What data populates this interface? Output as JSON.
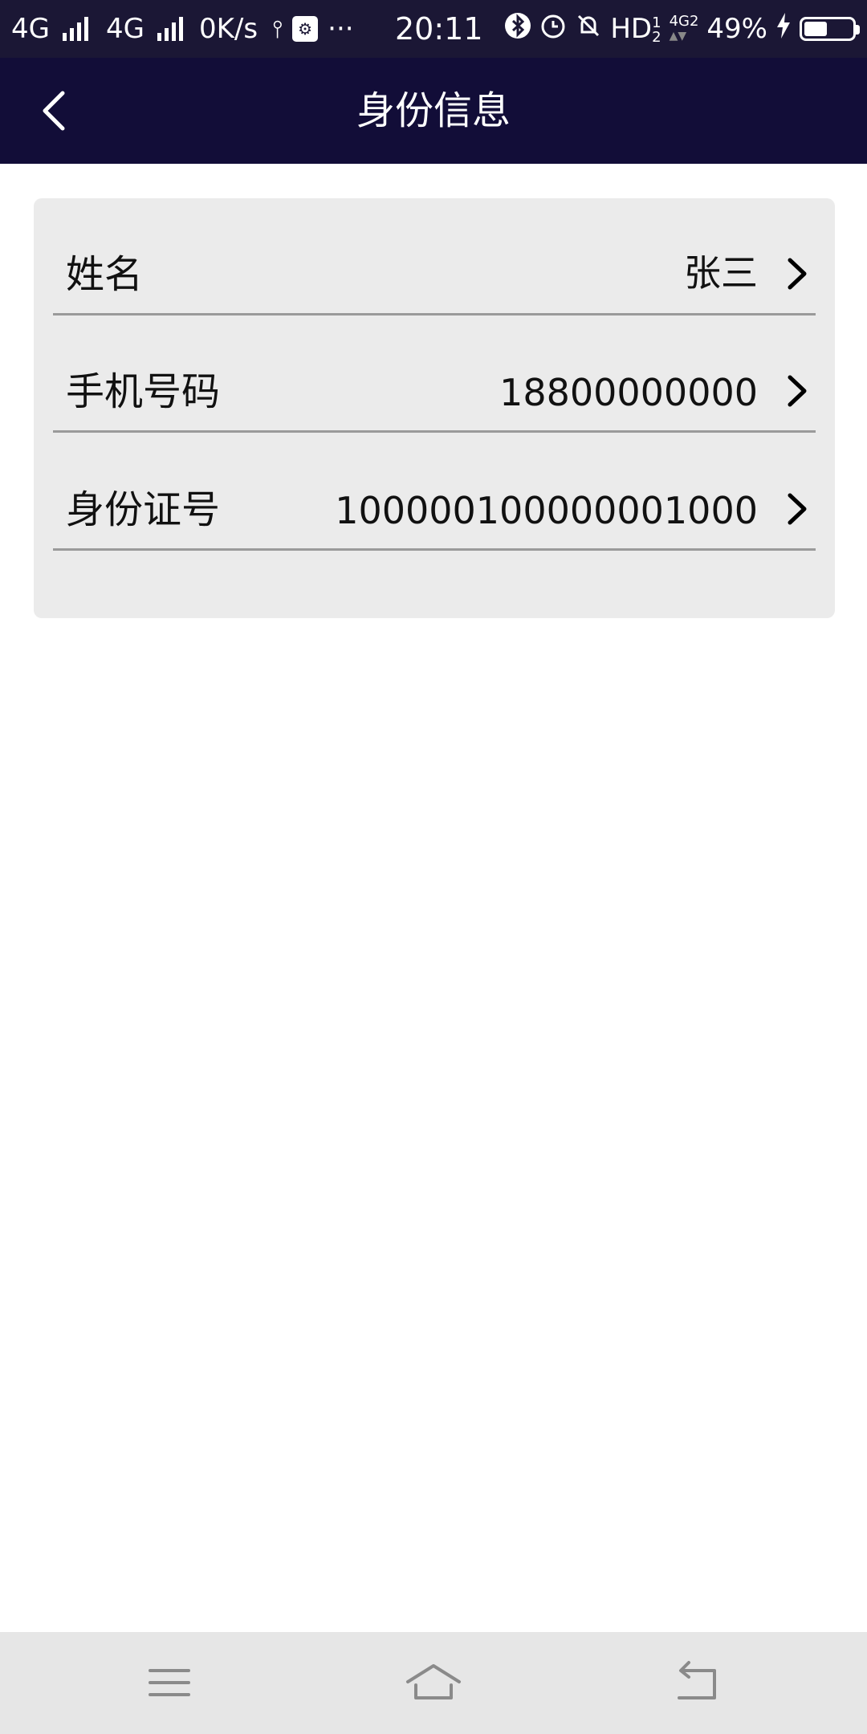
{
  "status_bar": {
    "network1": "4G",
    "network2": "4G",
    "speed": "0K/s",
    "more": "···",
    "time": "20:11",
    "hd": "HD",
    "hd_sup": "1",
    "hd_sub": "2",
    "net_small": "4G",
    "net_small_sub": "2",
    "battery_percent": "49%",
    "battery_level": 0.49
  },
  "header": {
    "title": "身份信息"
  },
  "rows": [
    {
      "label": "姓名",
      "value": "张三"
    },
    {
      "label": "手机号码",
      "value": "18800000000"
    },
    {
      "label": "身份证号",
      "value": "100000100000001000"
    }
  ],
  "colors": {
    "status_bg": "#1b1735",
    "header_bg": "#120d38",
    "card_bg": "#ebebeb",
    "divider": "#9a9a9a",
    "nav_bg": "#e6e6e6"
  }
}
